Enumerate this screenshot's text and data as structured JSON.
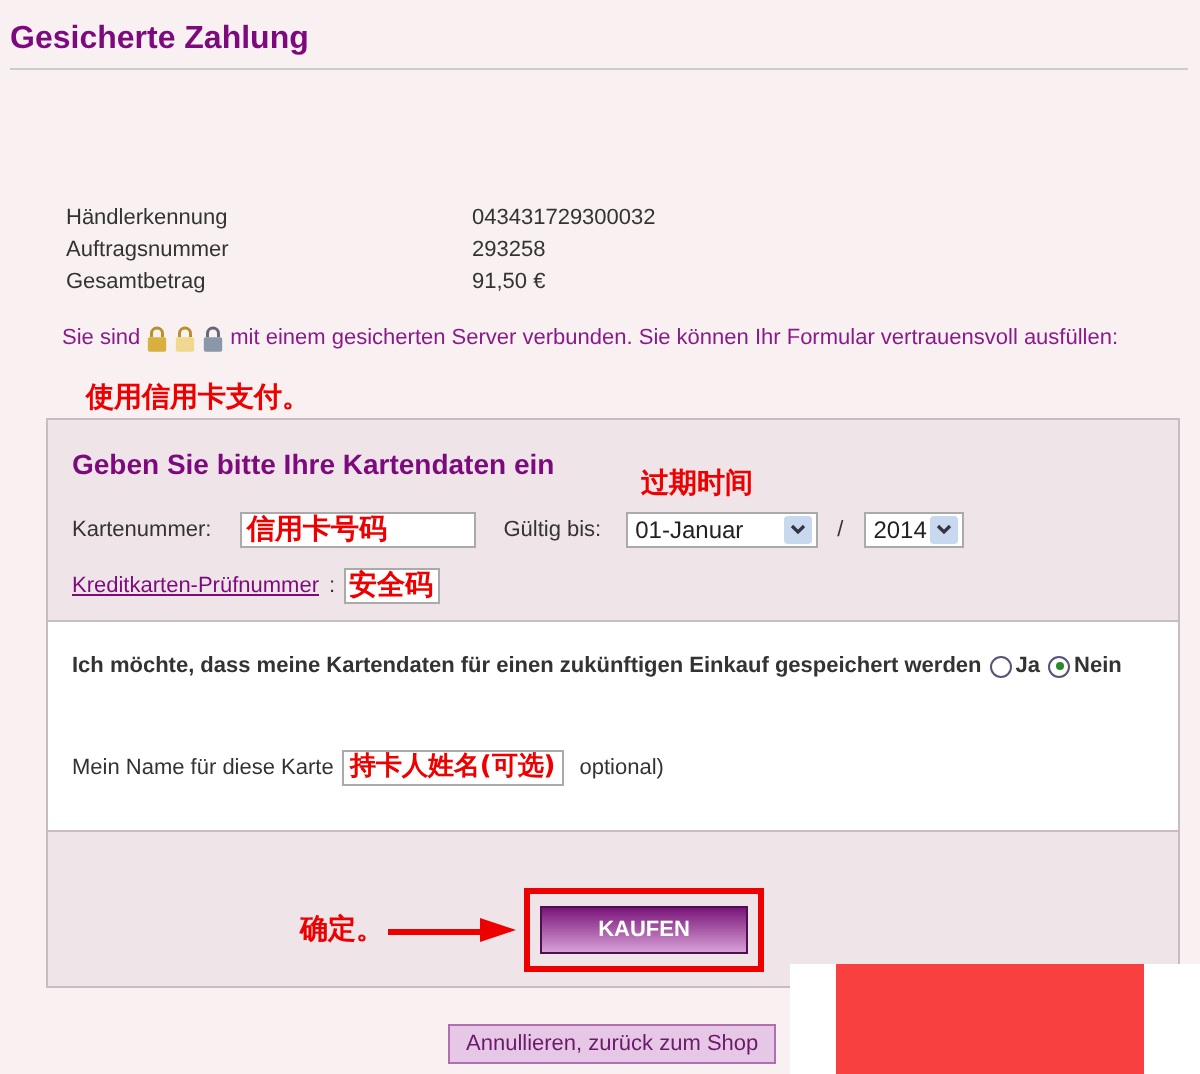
{
  "title": "Gesicherte Zahlung",
  "info": [
    {
      "label": "Händlerkennung",
      "value": "043431729300032"
    },
    {
      "label": "Auftragsnummer",
      "value": "293258"
    },
    {
      "label": "Gesamtbetrag",
      "value": "91,50 €"
    }
  ],
  "secure_text": {
    "before": "Sie sind",
    "after": "mit einem gesicherten Server verbunden. Sie können Ihr Formular vertrauensvoll ausfüllen:"
  },
  "annotations": [
    {
      "text": "使用信用卡支付。"
    },
    {
      "text": "过期时间"
    },
    {
      "text": "确定。"
    }
  ],
  "card_panel": {
    "heading": "Geben Sie bitte Ihre Kartendaten ein",
    "card_number": {
      "label": "Kartenummer:",
      "value": "信用卡号码"
    },
    "expiry": {
      "label": "Gültig bis:",
      "month": "01-Januar",
      "separator": "/",
      "year": "2014"
    },
    "cvc": {
      "link": "Kreditkarten-Prüfnummer",
      "colon": ":",
      "value": "安全码"
    }
  },
  "save_panel": {
    "question": "Ich möchte, dass meine Kartendaten für einen zukünftigen Einkauf gespeichert werden",
    "options": [
      {
        "label": "Ja",
        "selected": false
      },
      {
        "label": "Nein",
        "selected": true
      }
    ],
    "name_label": "Mein Name für diese Karte",
    "name_value": "持卡人姓名(可选)",
    "name_hint": "optional)"
  },
  "buy_button": "KAUFEN",
  "cancel_button": "Annullieren, zurück zum Shop"
}
